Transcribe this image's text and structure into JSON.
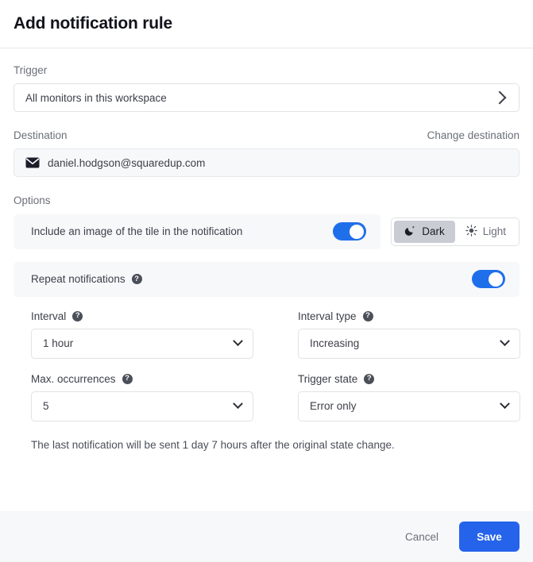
{
  "header": {
    "title": "Add notification rule"
  },
  "trigger": {
    "label": "Trigger",
    "value": "All monitors in this workspace",
    "chevron_icon": "chevron-right-icon"
  },
  "destination": {
    "label": "Destination",
    "change_link": "Change destination",
    "value": "daniel.hodgson@squaredup.com",
    "icon": "mail-icon"
  },
  "options": {
    "label": "Options",
    "include_image": {
      "label": "Include an image of the tile in the notification",
      "toggle_on": true
    },
    "theme": {
      "dark_label": "Dark",
      "dark_icon": "moon-icon",
      "light_label": "Light",
      "light_icon": "sun-icon",
      "selected": "Dark"
    },
    "repeat": {
      "label": "Repeat notifications",
      "help_icon": "help-icon",
      "toggle_on": true
    }
  },
  "fields": {
    "interval": {
      "label": "Interval",
      "help_icon": "help-icon",
      "value": "1 hour",
      "chevron_icon": "chevron-down-icon"
    },
    "interval_type": {
      "label": "Interval type",
      "help_icon": "help-icon",
      "value": "Increasing",
      "chevron_icon": "chevron-down-icon"
    },
    "max_occurrences": {
      "label": "Max. occurrences",
      "help_icon": "help-icon",
      "value": "5",
      "chevron_icon": "chevron-down-icon"
    },
    "trigger_state": {
      "label": "Trigger state",
      "help_icon": "help-icon",
      "value": "Error only",
      "chevron_icon": "chevron-down-icon"
    }
  },
  "note": "The last notification will be sent 1 day 7 hours after the original state change.",
  "footer": {
    "cancel_label": "Cancel",
    "save_label": "Save"
  },
  "help_glyph": "?",
  "colors": {
    "accent": "#2563eb",
    "toggle_on": "#1f6feb",
    "segment_active": "#c9ccd3",
    "panel": "#f7f8fa"
  }
}
